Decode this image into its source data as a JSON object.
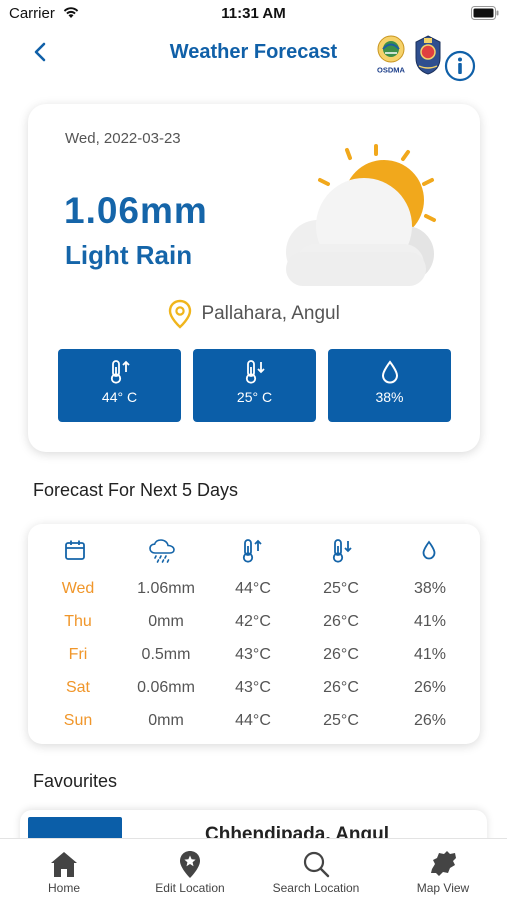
{
  "status_bar": {
    "carrier": "Carrier",
    "time": "11:31 AM"
  },
  "header": {
    "title": "Weather Forecast",
    "logo_text": "OSDMA"
  },
  "today": {
    "date": "Wed, 2022-03-23",
    "rainfall": "1.06mm",
    "description": "Light Rain",
    "location": "Pallahara, Angul",
    "max_temp": "44° C",
    "min_temp": "25° C",
    "humidity": "38%"
  },
  "forecast": {
    "title": "Forecast For Next 5 Days",
    "icons": [
      "calendar-icon",
      "rain-cloud-icon",
      "thermometer-up-icon",
      "thermometer-down-icon",
      "droplet-icon"
    ],
    "rows": [
      {
        "day": "Wed",
        "rain": "1.06mm",
        "max": "44°C",
        "min": "25°C",
        "humidity": "38%"
      },
      {
        "day": "Thu",
        "rain": "0mm",
        "max": "42°C",
        "min": "26°C",
        "humidity": "41%"
      },
      {
        "day": "Fri",
        "rain": "0.5mm",
        "max": "43°C",
        "min": "26°C",
        "humidity": "41%"
      },
      {
        "day": "Sat",
        "rain": "0.06mm",
        "max": "43°C",
        "min": "26°C",
        "humidity": "26%"
      },
      {
        "day": "Sun",
        "rain": "0mm",
        "max": "44°C",
        "min": "25°C",
        "humidity": "26%"
      }
    ]
  },
  "favourites": {
    "title": "Favourites",
    "items": [
      {
        "name": "Chhendipada, Angul"
      }
    ]
  },
  "tabs": [
    {
      "label": "Home",
      "icon": "home-icon"
    },
    {
      "label": "Edit Location",
      "icon": "location-pin-icon"
    },
    {
      "label": "Search Location",
      "icon": "search-icon"
    },
    {
      "label": "Map View",
      "icon": "map-icon"
    }
  ],
  "colors": {
    "primary": "#0b5ea8",
    "title_blue": "#1565a9",
    "day_orange": "#f0962a",
    "sun": "#f1a81c"
  }
}
